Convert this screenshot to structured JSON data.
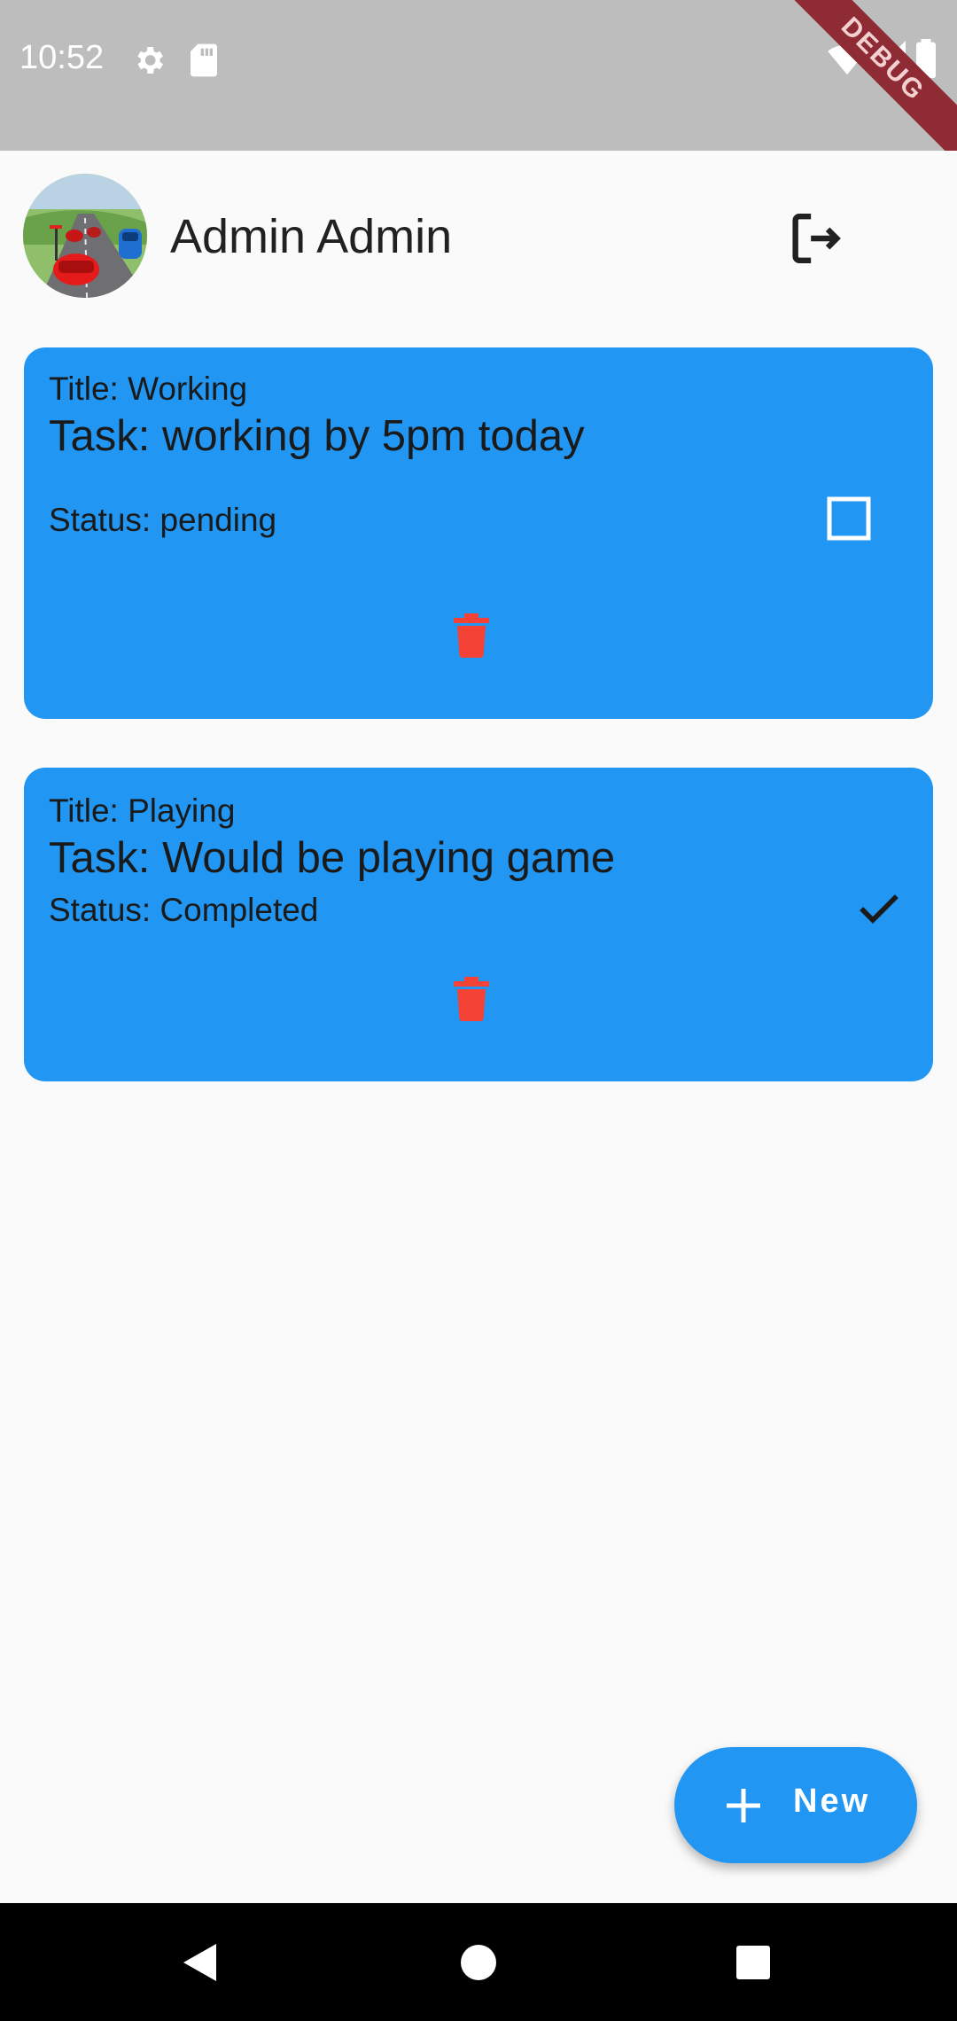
{
  "status_bar": {
    "time": "10:52",
    "icons": [
      "settings-icon",
      "sd-card-icon",
      "wifi-icon",
      "signal-icon",
      "battery-icon"
    ],
    "debug_banner": "DEBUG"
  },
  "header": {
    "user_name": "Admin Admin",
    "avatar_icon": "avatar-racing-car-image",
    "logout_icon": "logout-icon"
  },
  "tasks": [
    {
      "title": "Title: Working",
      "task": "Task: working by 5pm today",
      "status": "Status: pending",
      "completed": false,
      "status_icon": "checkbox-empty-icon",
      "delete_icon": "trash-icon"
    },
    {
      "title": "Title: Playing",
      "task": "Task: Would be playing game",
      "status": "Status: Completed",
      "completed": true,
      "status_icon": "check-icon",
      "delete_icon": "trash-icon"
    }
  ],
  "fab": {
    "label": "New",
    "icon": "plus-icon"
  },
  "nav_bar": {
    "icons": [
      "back-icon",
      "home-icon",
      "recents-icon"
    ]
  },
  "colors": {
    "card": "#2196f3",
    "delete": "#f44336",
    "status_bar": "#bdbdbd",
    "debug_banner": "#8e2b34"
  }
}
